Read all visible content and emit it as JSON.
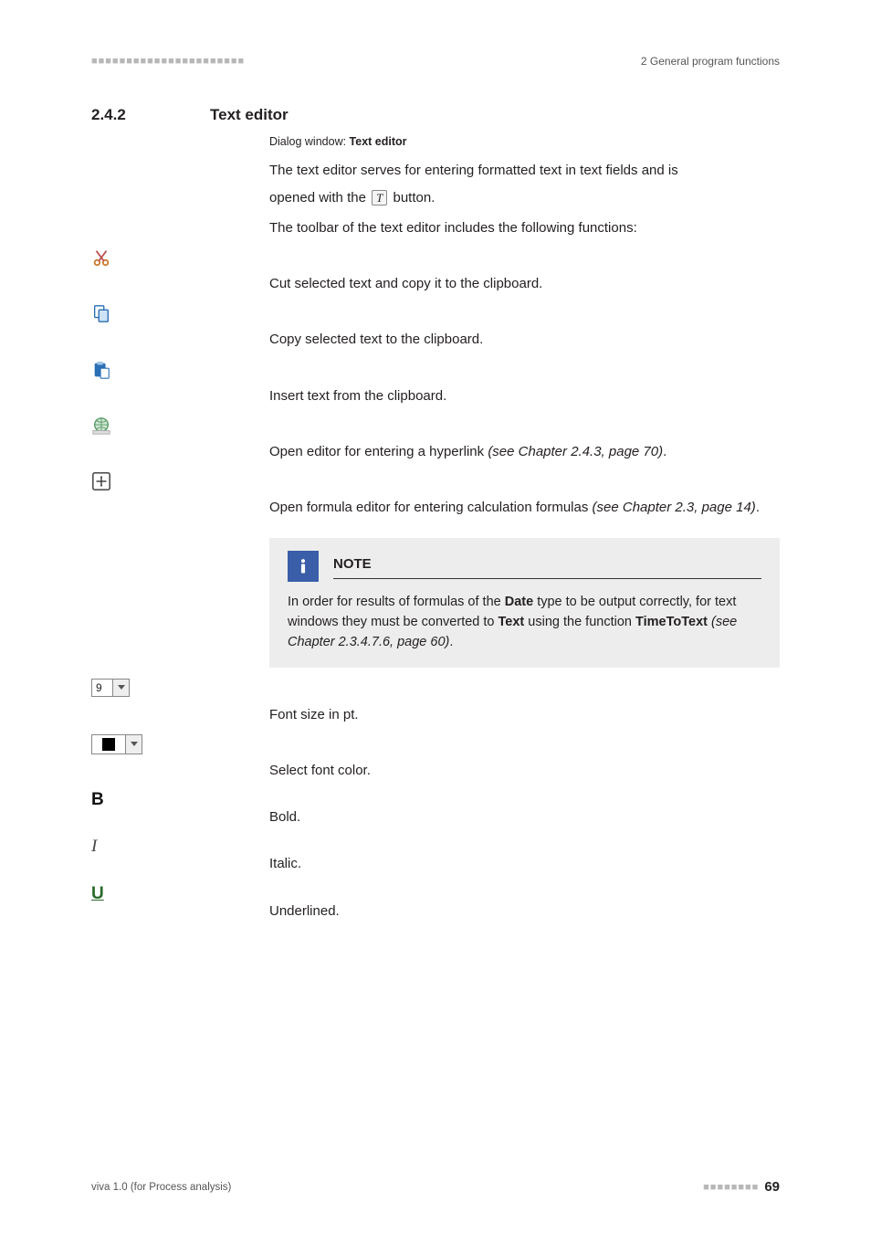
{
  "header": {
    "dashes": "■■■■■■■■■■■■■■■■■■■■■■",
    "right": "2 General program functions"
  },
  "section": {
    "number": "2.4.2",
    "title": "Text editor"
  },
  "intro": {
    "dialog_prefix": "Dialog window: ",
    "dialog_title": "Text editor",
    "line1_a": "The text editor serves for entering formatted text in text fields and is",
    "line2_a": "opened with the ",
    "line2_b": " button.",
    "line3": "The toolbar of the text editor includes the following functions:"
  },
  "items": {
    "cut": "Cut selected text and copy it to the clipboard.",
    "copy": "Copy selected text to the clipboard.",
    "paste": "Insert text from the clipboard.",
    "hyperlink_a": "Open editor for entering a hyperlink ",
    "hyperlink_b": "(see Chapter 2.4.3, page 70)",
    "hyperlink_c": ".",
    "formula_a": "Open formula editor for entering calculation formulas ",
    "formula_b": "(see Chapter 2.3, page 14)",
    "formula_c": ".",
    "fontsize": "Font size in pt.",
    "fontcolor": "Select font color.",
    "bold": "Bold.",
    "italic": "Italic.",
    "underline": "Underlined."
  },
  "fontsize_value": "9",
  "note": {
    "title": "NOTE",
    "line_a": "In order for results of formulas of the ",
    "line_date": "Date",
    "line_b": " type to be output correctly, for text windows they must be converted to ",
    "line_text": "Text",
    "line_c": " using the function ",
    "line_fn": "TimeToText",
    "line_d": " ",
    "line_ref": "(see Chapter 2.3.4.7.6, page 60)",
    "line_e": "."
  },
  "footer": {
    "left": "viva 1.0 (for Process analysis)",
    "dashes": "■■■■■■■■",
    "page": "69"
  },
  "icon_letters": {
    "t": "T",
    "b": "B",
    "i": "I",
    "u": "U"
  }
}
